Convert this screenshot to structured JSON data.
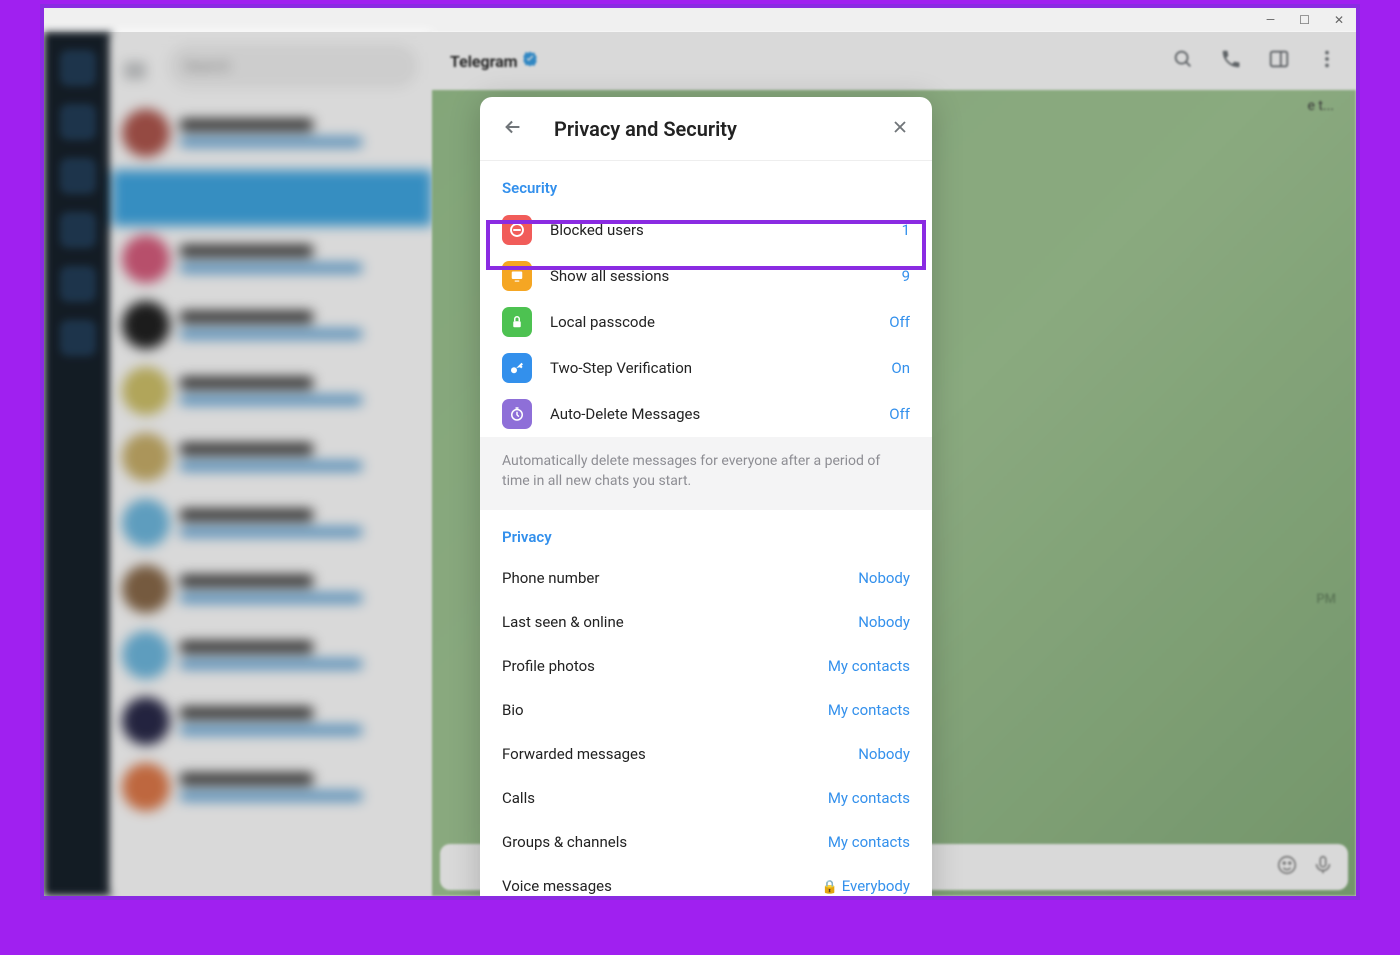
{
  "window": {
    "minimize": "—",
    "maximize": "☐",
    "close": "✕"
  },
  "search": {
    "placeholder": "Search"
  },
  "header": {
    "title": "Telegram"
  },
  "modal": {
    "title": "Privacy and Security",
    "section_security": "Security",
    "section_privacy": "Privacy",
    "description": "Automatically delete messages for everyone after a period of time in all new chats you start.",
    "security_items": [
      {
        "label": "Blocked users",
        "value": "1",
        "color": "#f15c59"
      },
      {
        "label": "Show all sessions",
        "value": "9",
        "color": "#f5a623"
      },
      {
        "label": "Local passcode",
        "value": "Off",
        "color": "#4dc251"
      },
      {
        "label": "Two-Step Verification",
        "value": "On",
        "color": "#3390ec"
      },
      {
        "label": "Auto-Delete Messages",
        "value": "Off",
        "color": "#8e6fd8"
      }
    ],
    "privacy_items": [
      {
        "label": "Phone number",
        "value": "Nobody"
      },
      {
        "label": "Last seen & online",
        "value": "Nobody"
      },
      {
        "label": "Profile photos",
        "value": "My contacts"
      },
      {
        "label": "Bio",
        "value": "My contacts"
      },
      {
        "label": "Forwarded messages",
        "value": "Nobody"
      },
      {
        "label": "Calls",
        "value": "My contacts"
      },
      {
        "label": "Groups & channels",
        "value": "My contacts"
      },
      {
        "label": "Voice messages",
        "value": "Everybody",
        "locked": true
      }
    ]
  },
  "bg_hints": {
    "et": "e t...",
    "pm": "PM"
  }
}
